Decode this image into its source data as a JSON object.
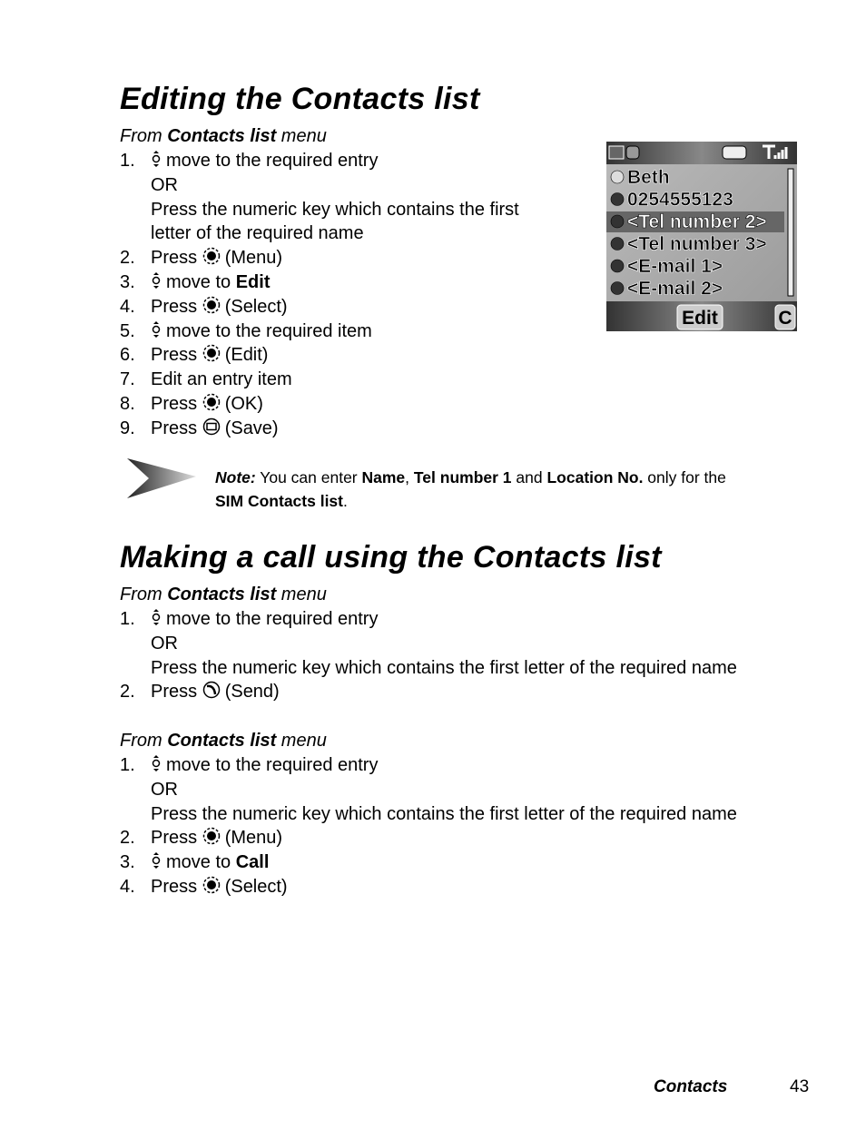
{
  "section1": {
    "title": "Editing the Contacts list",
    "from": {
      "pre": "From ",
      "bold": "Contacts list",
      "post": " menu"
    },
    "steps": [
      {
        "n": "1.",
        "icon": "navigate-updown-icon",
        "text": "move to the required entry"
      },
      {
        "n": "",
        "icon": "",
        "text": "OR"
      },
      {
        "n": "",
        "icon": "",
        "text": "Press the numeric key which contains the first"
      },
      {
        "n": "",
        "icon": "",
        "text": "letter of the required name"
      },
      {
        "n": "2.",
        "pre": "Press",
        "icon": "center-key-icon",
        "text": "(Menu)"
      },
      {
        "n": "3.",
        "icon": "navigate-updown-icon",
        "text": "move to ",
        "bold": "Edit"
      },
      {
        "n": "4.",
        "pre": "Press",
        "icon": "center-key-icon",
        "text": "(Select)"
      },
      {
        "n": "5.",
        "icon": "navigate-updown-icon",
        "text": "move to the required item"
      },
      {
        "n": "6.",
        "pre": "Press",
        "icon": "center-key-icon",
        "text": "(Edit)"
      },
      {
        "n": "7.",
        "icon": "",
        "text": "Edit an entry item"
      },
      {
        "n": "8.",
        "pre": "Press",
        "icon": "center-key-icon",
        "text": "(OK)"
      },
      {
        "n": "9.",
        "pre": "Press",
        "icon": "soft-key-icon",
        "text": "(Save)"
      }
    ]
  },
  "note": {
    "label": "Note:",
    "t1": " You can enter ",
    "b1": "Name",
    "t2": ", ",
    "b2": "Tel number 1",
    "t3": " and ",
    "b3": "Location No.",
    "t4": " only for the ",
    "b4": "SIM Contacts list",
    "t5": "."
  },
  "phone_screen": {
    "entries": [
      "Beth",
      "0254555123",
      "<Tel number 2>",
      "<Tel number 3>",
      "<E-mail 1>",
      "<E-mail 2>"
    ],
    "selected_index": 2,
    "softkey": "Edit",
    "clear_key": "C"
  },
  "section2": {
    "title": "Making a call using the Contacts list",
    "block1": {
      "from": {
        "pre": "From ",
        "bold": "Contacts list",
        "post": " menu"
      },
      "steps": [
        {
          "n": "1.",
          "icon": "navigate-updown-icon",
          "text": "move to the required entry"
        },
        {
          "n": "",
          "icon": "",
          "text": "OR"
        },
        {
          "n": "",
          "icon": "",
          "text": "Press the numeric key which contains the first letter of the required name"
        },
        {
          "n": "2.",
          "pre": "Press",
          "icon": "send-key-icon",
          "text": "(Send)"
        }
      ]
    },
    "block2": {
      "from": {
        "pre": "From ",
        "bold": "Contacts list",
        "post": " menu"
      },
      "steps": [
        {
          "n": "1.",
          "icon": "navigate-updown-icon",
          "text": "move to the required entry"
        },
        {
          "n": "",
          "icon": "",
          "text": "OR"
        },
        {
          "n": "",
          "icon": "",
          "text": "Press the numeric key which contains the first letter of the required name"
        },
        {
          "n": "2.",
          "pre": "Press",
          "icon": "center-key-icon",
          "text": "(Menu)"
        },
        {
          "n": "3.",
          "icon": "navigate-updown-icon",
          "text": "move to ",
          "bold": "Call"
        },
        {
          "n": "4.",
          "pre": "Press",
          "icon": "center-key-icon",
          "text": "(Select)"
        }
      ]
    }
  },
  "footer": {
    "section": "Contacts",
    "page": "43"
  }
}
